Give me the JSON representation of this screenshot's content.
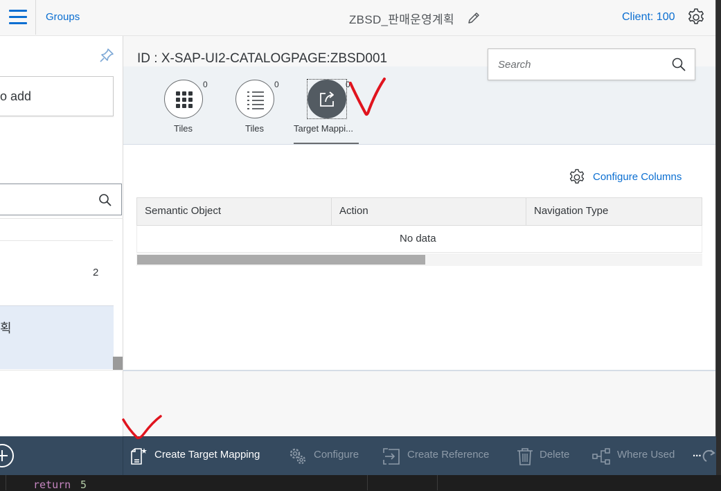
{
  "left_panel": {
    "groups_label": "Groups",
    "add_text": "o add",
    "count": "2",
    "selected_item_text": "획"
  },
  "header": {
    "title": "ZBSD_판매운영계획",
    "client": "Client: 100"
  },
  "object": {
    "id": "ID : X-SAP-UI2-CATALOGPAGE:ZBSD001",
    "search_placeholder": "Search"
  },
  "tabs": [
    {
      "label": "Tiles",
      "count": "0",
      "icon": "grid-icon"
    },
    {
      "label": "Tiles",
      "count": "0",
      "icon": "list-icon"
    },
    {
      "label": "Target Mappi...",
      "count": "0",
      "icon": "share-icon",
      "selected": true
    }
  ],
  "content": {
    "configure_columns": "Configure Columns",
    "columns": [
      "Semantic Object",
      "Action",
      "Navigation Type"
    ],
    "no_data": "No data"
  },
  "footer": {
    "create_target_mapping": "Create Target Mapping",
    "configure": "Configure",
    "create_reference": "Create Reference",
    "delete": "Delete",
    "where_used": "Where Used",
    "more": "..."
  },
  "editor": {
    "keyword": "return",
    "number": "5"
  },
  "colors": {
    "accent": "#0a6ed1",
    "footer_bg": "#354a5f",
    "annotation": "#e0141e"
  }
}
